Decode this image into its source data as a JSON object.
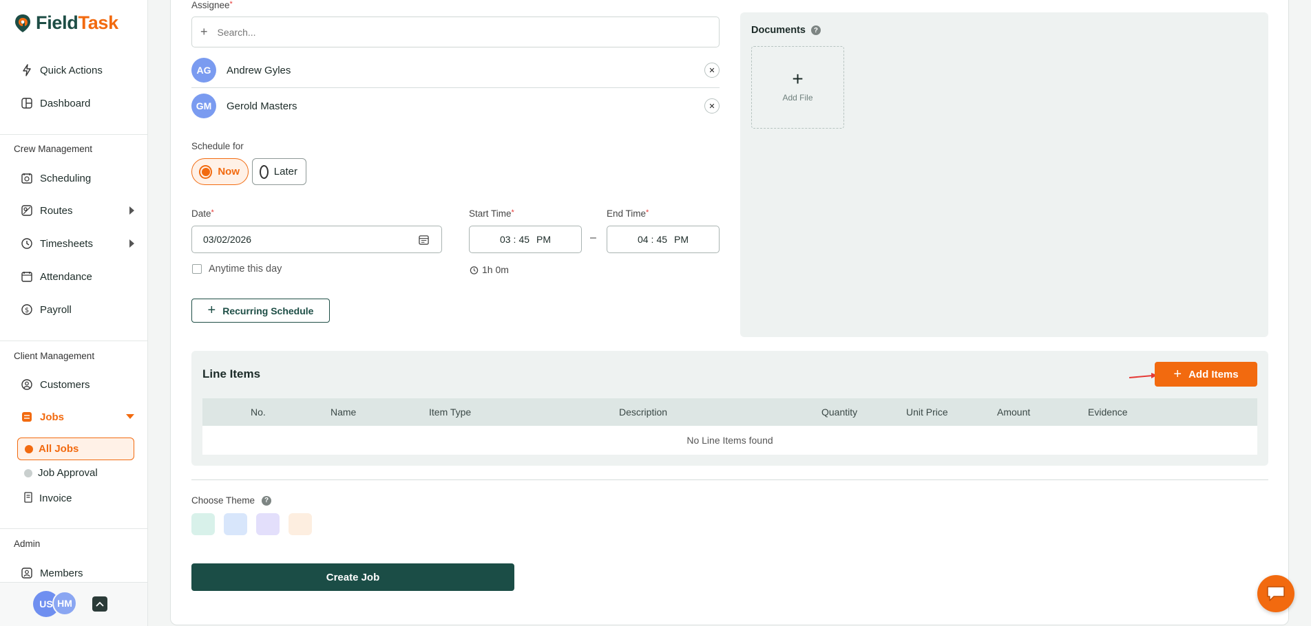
{
  "brand": {
    "name_part1": "Field",
    "name_part2": "Task"
  },
  "sidebar": {
    "top_items": [
      {
        "label": "Quick Actions"
      },
      {
        "label": "Dashboard"
      }
    ],
    "crew_section": "Crew Management",
    "crew_items": [
      {
        "label": "Scheduling"
      },
      {
        "label": "Routes"
      },
      {
        "label": "Timesheets"
      },
      {
        "label": "Attendance"
      },
      {
        "label": "Payroll"
      }
    ],
    "client_section": "Client Management",
    "client_items": [
      {
        "label": "Customers"
      },
      {
        "label": "Jobs"
      }
    ],
    "job_sub_items": [
      {
        "label": "All Jobs"
      },
      {
        "label": "Job Approval"
      },
      {
        "label": "Invoice"
      }
    ],
    "admin_section": "Admin",
    "admin_items": [
      {
        "label": "Members"
      }
    ],
    "footer_avatars": [
      "US",
      "HM"
    ]
  },
  "form": {
    "assignee_label": "Assignee",
    "search_placeholder": "Search...",
    "assignees": [
      {
        "initials": "AG",
        "name": "Andrew Gyles"
      },
      {
        "initials": "GM",
        "name": "Gerold Masters"
      }
    ],
    "schedule_label": "Schedule for",
    "schedule_options": [
      "Now",
      "Later"
    ],
    "date_label": "Date",
    "date_value": "03/02/2026",
    "start_time_label": "Start Time",
    "start_time": {
      "hh": "03",
      "mm": "45",
      "ampm": "PM"
    },
    "end_time_label": "End Time",
    "end_time": {
      "hh": "04",
      "mm": "45",
      "ampm": "PM"
    },
    "time_separator": "–",
    "anytime_label": "Anytime this day",
    "duration": "1h 0m",
    "recurring_label": "Recurring Schedule",
    "documents_label": "Documents",
    "add_file_label": "Add File",
    "line_items_title": "Line Items",
    "add_items_label": "Add Items",
    "table_columns": [
      "No.",
      "Name",
      "Item Type",
      "Description",
      "Quantity",
      "Unit Price",
      "Amount",
      "Evidence"
    ],
    "empty_message": "No Line Items found",
    "theme_label": "Choose Theme",
    "theme_colors": [
      "#d8f1ea",
      "#d8e6fb",
      "#e3dffb",
      "#fdeee0"
    ],
    "create_label": "Create Job"
  },
  "colors": {
    "accent": "#f26a0f",
    "primary": "#1b4d46",
    "avatar_blue": "#7a9bf0"
  }
}
